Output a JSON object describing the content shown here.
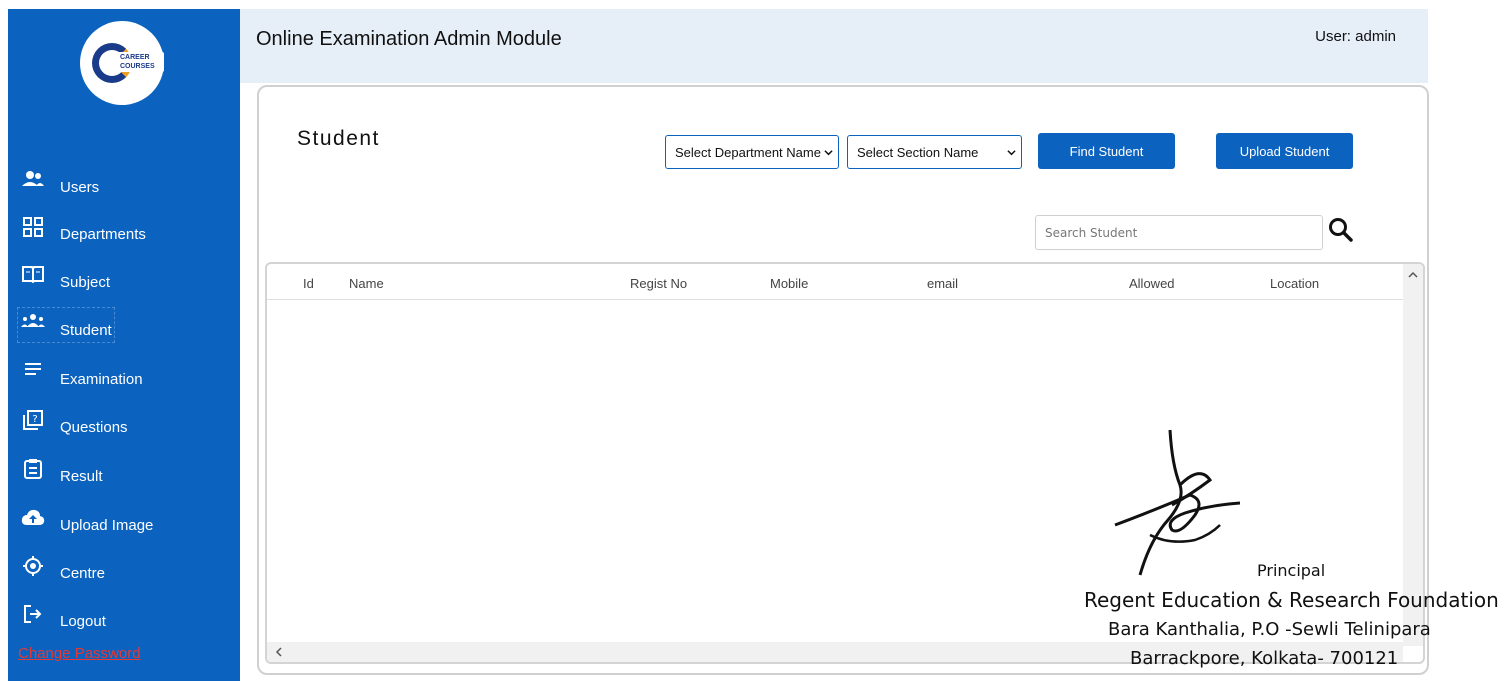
{
  "sidebar": {
    "logo_text": "CAREER COURSES",
    "items": [
      {
        "label": "Users",
        "icon": "users-icon"
      },
      {
        "label": "Departments",
        "icon": "grid-icon"
      },
      {
        "label": "Subject",
        "icon": "book-icon"
      },
      {
        "label": "Student",
        "icon": "group-icon"
      },
      {
        "label": "Examination",
        "icon": "list-icon"
      },
      {
        "label": "Questions",
        "icon": "question-icon"
      },
      {
        "label": "Result",
        "icon": "clipboard-icon"
      },
      {
        "label": "Upload Image",
        "icon": "cloud-upload-icon"
      },
      {
        "label": "Centre",
        "icon": "target-icon"
      },
      {
        "label": "Logout",
        "icon": "logout-icon"
      }
    ],
    "change_password": "Change Password"
  },
  "header": {
    "title": "Online Examination Admin Module",
    "user": "User: admin"
  },
  "main": {
    "page_title": "Student",
    "department_select": "Select Department Name",
    "section_select": "Select Section Name",
    "find_button": "Find Student",
    "upload_button": "Upload Student",
    "search_placeholder": "Search Student",
    "columns": [
      "Id",
      "Name",
      "Regist No",
      "Mobile",
      "email",
      "Allowed",
      "Location"
    ]
  },
  "stamp": {
    "line1": "Principal",
    "line2": "Regent Education & Research Foundation",
    "line3": "Bara Kanthalia, P.O -Sewli Telinipara",
    "line4": "Barrackpore, Kolkata- 700121"
  },
  "colors": {
    "sidebar": "#0b62bf",
    "header": "#e6eef8",
    "button": "#0b62bf",
    "change_password": "#e53935"
  }
}
